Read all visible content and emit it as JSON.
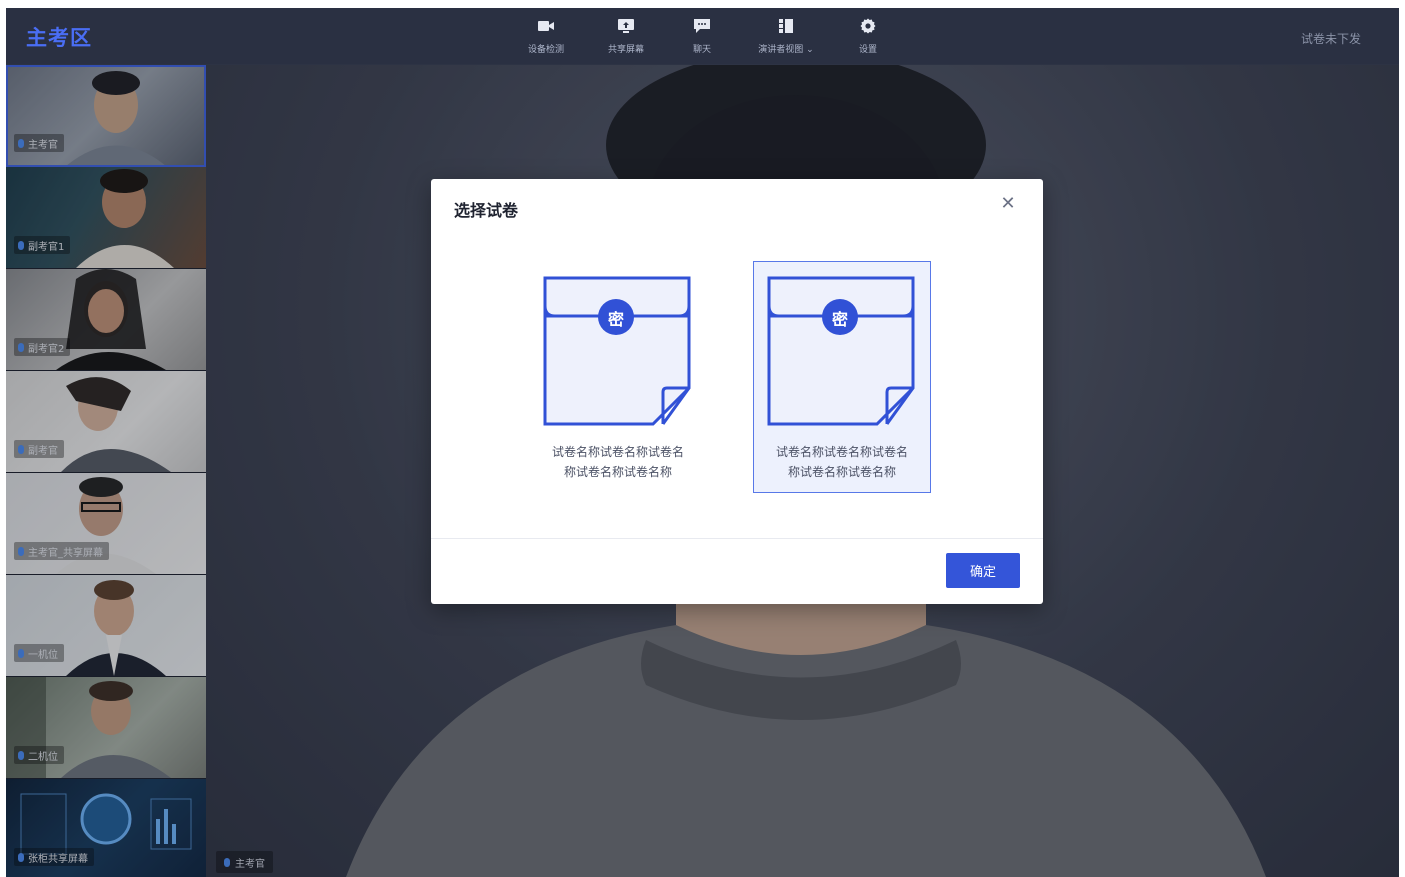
{
  "header": {
    "title": "主考区",
    "status": "试卷未下发",
    "tools": [
      {
        "label": "设备检测",
        "icon": "camera-icon"
      },
      {
        "label": "共享屏幕",
        "icon": "share-screen-icon"
      },
      {
        "label": "聊天",
        "icon": "chat-icon"
      },
      {
        "label": "演讲者视图",
        "icon": "speaker-view-icon"
      },
      {
        "label": "设置",
        "icon": "gear-icon"
      }
    ]
  },
  "sidebar": {
    "participants": [
      {
        "label": "主考官"
      },
      {
        "label": "副考官1"
      },
      {
        "label": "副考官2"
      },
      {
        "label": "副考官"
      },
      {
        "label": "主考官_共享屏幕"
      },
      {
        "label": "一机位"
      },
      {
        "label": "二机位"
      },
      {
        "label": "张柜共享屏幕"
      }
    ]
  },
  "stage": {
    "label": "主考官"
  },
  "modal": {
    "title": "选择试卷",
    "close_icon": "close-icon",
    "papers": [
      {
        "badge": "密",
        "name": "试卷名称试卷名称试卷名称试卷名称试卷名称",
        "selected": false
      },
      {
        "badge": "密",
        "name": "试卷名称试卷名称试卷名称试卷名称试卷名称",
        "selected": true
      }
    ],
    "confirm_label": "确定"
  },
  "colors": {
    "accent": "#3455d9",
    "brand": "#4a6ef5",
    "selected_bg": "#edf1fd",
    "doc_stroke": "#3151d6"
  }
}
